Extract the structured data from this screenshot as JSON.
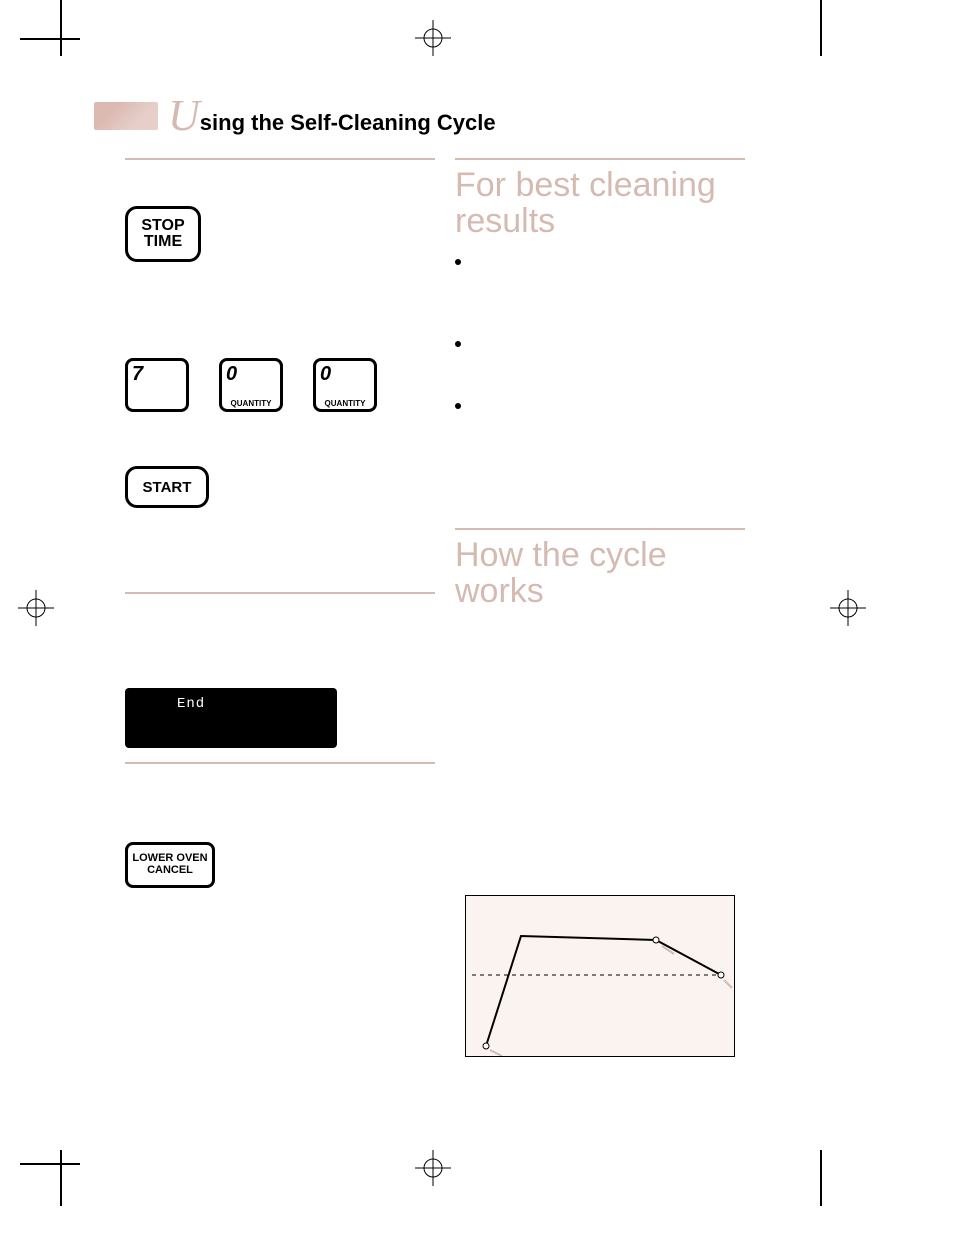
{
  "title": {
    "u": "U",
    "rest": "sing the Self-Cleaning Cycle"
  },
  "left": {
    "stop_time": "STOP\nTIME",
    "digits": {
      "d1": "7",
      "d2": "0",
      "d2_sub": "QUANTITY",
      "d3": "0",
      "d3_sub": "QUANTITY"
    },
    "start": "START",
    "display_word": "End",
    "lower_cancel": "LOWER OVEN\nCANCEL"
  },
  "right": {
    "h1": "For best cleaning results",
    "h2": "How the cycle works",
    "bullets": [
      "",
      "",
      ""
    ]
  },
  "chart_data": {
    "type": "line",
    "title": "",
    "xlabel": "",
    "ylabel": "",
    "x": [
      0,
      0.15,
      0.75,
      1.0
    ],
    "y": [
      0,
      1.0,
      0.95,
      0.55
    ],
    "dashed_level": 0.55
  }
}
